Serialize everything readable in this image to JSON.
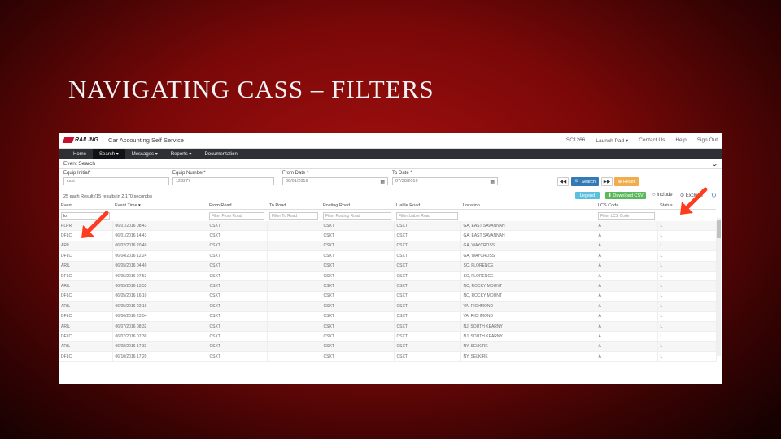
{
  "slide": {
    "title": "NAVIGATING CASS – FILTERS"
  },
  "app": {
    "logo_text": "RAILING",
    "title": "Car Accounting Self Service",
    "top_nav": [
      "SC1266",
      "Launch Pad ▾",
      "Contact Us",
      "Help",
      "Sign Out"
    ]
  },
  "nav": [
    "Home",
    "Search ▾",
    "Messages ▾",
    "Reports ▾",
    "Documentation"
  ],
  "section": {
    "title": "Event Search"
  },
  "filters": {
    "equip_initial": {
      "label": "Equip Initial*",
      "value": "csxt"
    },
    "equip_number": {
      "label": "Equip Number*",
      "value": "123277"
    },
    "from_date": {
      "label": "From Date *",
      "value": "06/01/2016"
    },
    "to_date": {
      "label": "To Date *",
      "value": "07/30/2016"
    },
    "search_label": "Search",
    "reset_label": "Reset"
  },
  "toolbar": {
    "results_text": "25 each Result (15 results in 2.170 seconds)",
    "legend_label": "Legend",
    "download_label": "Download CSV",
    "include_label": "Include",
    "exclude_label": "Exclude",
    "refresh_icon": "refresh-icon"
  },
  "table": {
    "headers": [
      "Event",
      "Event Time ▾",
      "From Road",
      "To Road",
      "Posting Road",
      "Liable Road",
      "Location",
      "LCS Code",
      "Status"
    ],
    "filter_placeholders": [
      "",
      "",
      "Filter From Road",
      "Filter To Road",
      "Filter Posting Road",
      "Filter Liable Road",
      "",
      "Filter LCS Code",
      ""
    ],
    "event_filter_value": "lo",
    "rows": [
      [
        "PLPR",
        "06/01/2016 08:43",
        "CSXT",
        "",
        "CSXT",
        "CSXT",
        "GA, EAST SAVANNAH",
        "A",
        "L"
      ],
      [
        "DFLC",
        "06/01/2016 14:43",
        "CSXT",
        "",
        "CSXT",
        "CSXT",
        "GA, EAST SAVANNAH",
        "A",
        "L"
      ],
      [
        "ARIL",
        "06/02/2016 20:40",
        "CSXT",
        "",
        "CSXT",
        "CSXT",
        "GA, WAYCROSS",
        "A",
        "L"
      ],
      [
        "DFLC",
        "06/04/2016 12:24",
        "CSXT",
        "",
        "CSXT",
        "CSXT",
        "GA, WAYCROSS",
        "A",
        "L"
      ],
      [
        "ARIL",
        "06/05/2016 04:40",
        "CSXT",
        "",
        "CSXT",
        "CSXT",
        "SC, FLORENCE",
        "A",
        "L"
      ],
      [
        "DFLC",
        "06/05/2016 07:53",
        "CSXT",
        "",
        "CSXT",
        "CSXT",
        "SC, FLORENCE",
        "A",
        "L"
      ],
      [
        "ARIL",
        "06/05/2016 13:55",
        "CSXT",
        "",
        "CSXT",
        "CSXT",
        "NC, ROCKY MOUNT",
        "A",
        "L"
      ],
      [
        "DFLC",
        "06/05/2016 16:10",
        "CSXT",
        "",
        "CSXT",
        "CSXT",
        "NC, ROCKY MOUNT",
        "A",
        "L"
      ],
      [
        "ARIL",
        "06/05/2016 22:19",
        "CSXT",
        "",
        "CSXT",
        "CSXT",
        "VA, RICHMOND",
        "A",
        "L"
      ],
      [
        "DFLC",
        "06/06/2016 23:54",
        "CSXT",
        "",
        "CSXT",
        "CSXT",
        "VA, RICHMOND",
        "A",
        "L"
      ],
      [
        "ARIL",
        "06/07/2016 08:32",
        "CSXT",
        "",
        "CSXT",
        "CSXT",
        "NJ, SOUTH KEARNY",
        "A",
        "L"
      ],
      [
        "DFLC",
        "06/07/2016 07:30",
        "CSXT",
        "",
        "CSXT",
        "CSXT",
        "NJ, SOUTH KEARNY",
        "A",
        "L"
      ],
      [
        "ARIL",
        "06/08/2016 17:33",
        "CSXT",
        "",
        "CSXT",
        "CSXT",
        "NY, SELKIRK",
        "A",
        "L"
      ],
      [
        "DFLC",
        "06/10/2016 17:20",
        "CSXT",
        "",
        "CSXT",
        "CSXT",
        "NY, SELKIRK",
        "A",
        "L"
      ]
    ]
  },
  "colors": {
    "accent_blue": "#337ab7",
    "orange": "#f0ad4e",
    "green": "#5cb85c",
    "teal": "#5bc0de",
    "arrow": "#ff3b1f",
    "navbar": "#2e3036"
  }
}
